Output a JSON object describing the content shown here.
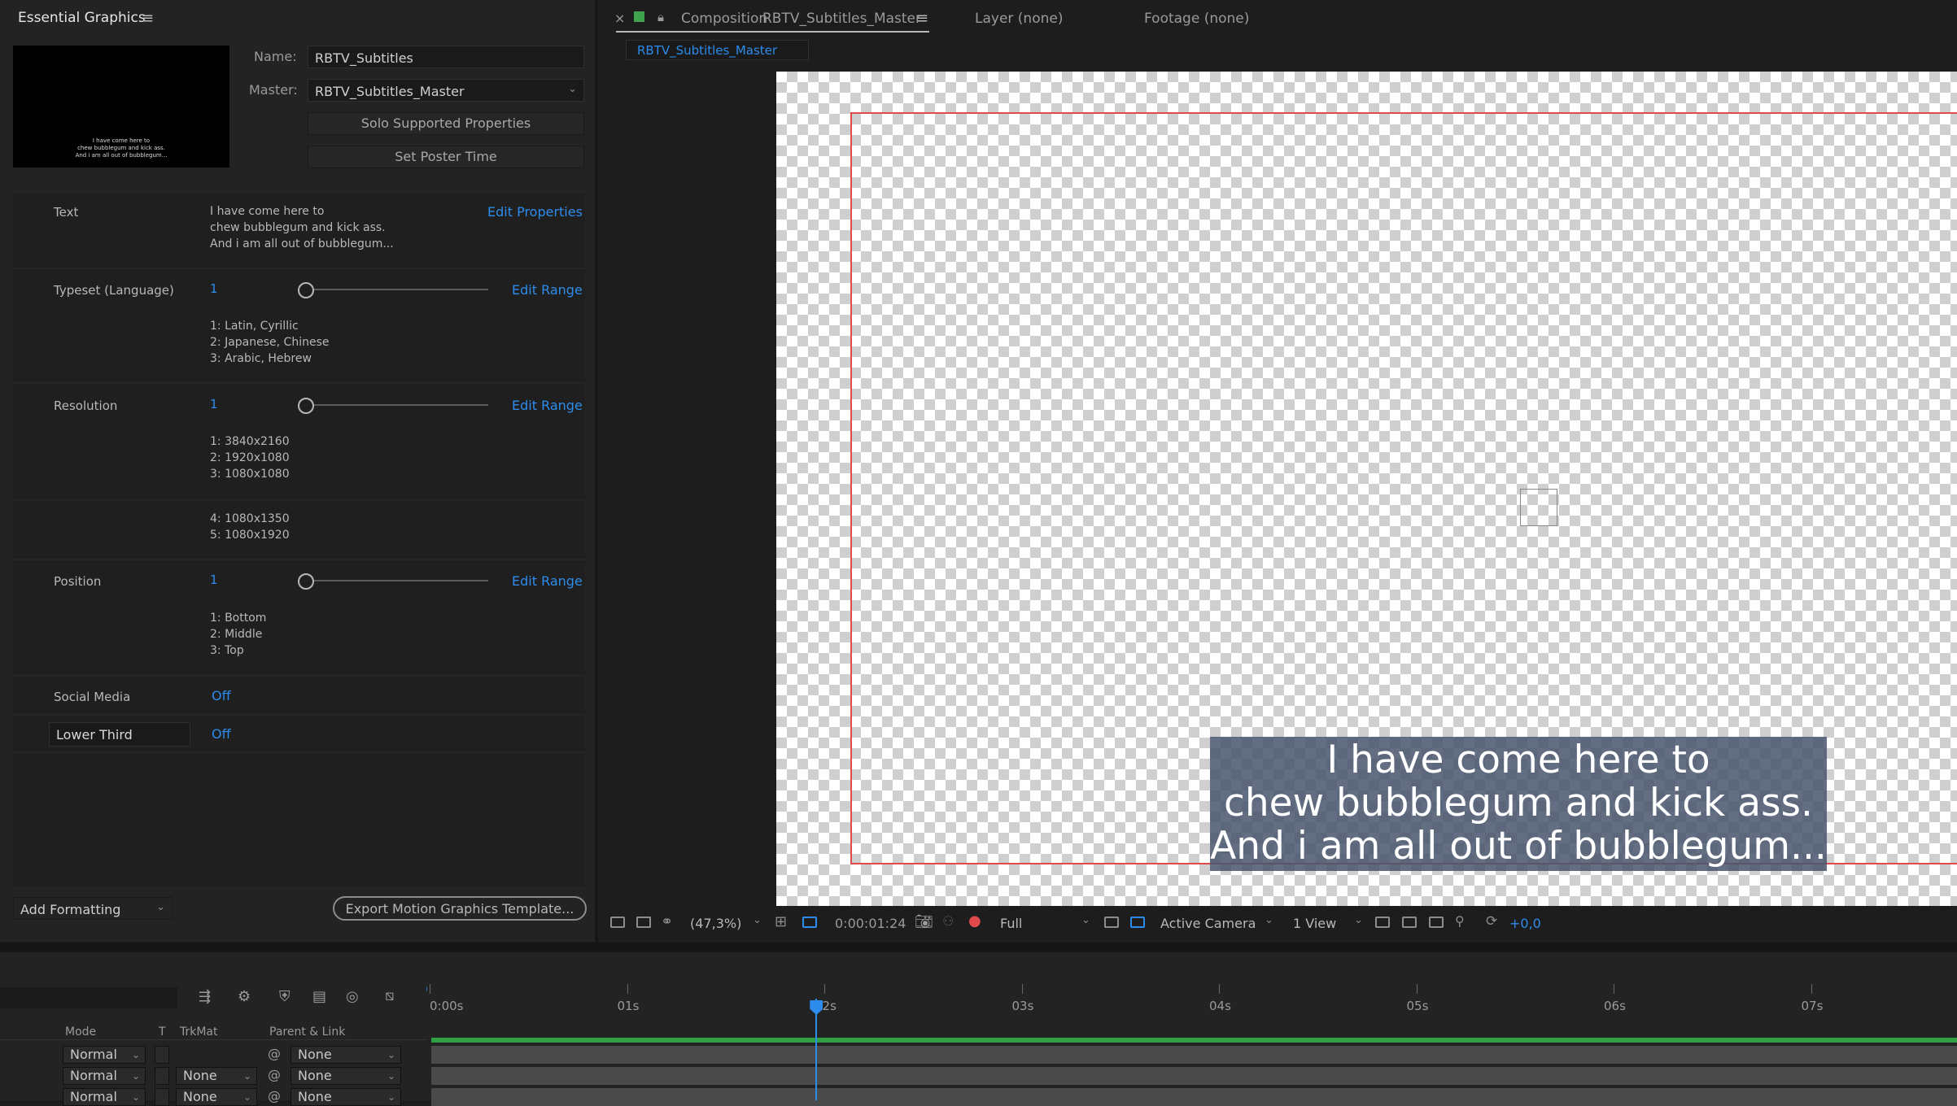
{
  "essential_graphics": {
    "title": "Essential Graphics",
    "menu_icon": "hamburger-icon",
    "thumbnail_text": "I have come here to\nchew bubblegum and kick ass.\nAnd i am all out of bubblegum...",
    "name_label": "Name:",
    "name_value": "RBTV_Subtitles",
    "master_label": "Master:",
    "master_value": "RBTV_Subtitles_Master",
    "solo_button": "Solo Supported Properties",
    "poster_button": "Set Poster Time",
    "properties": {
      "text": {
        "label": "Text",
        "value": "I have come here to\nchew bubblegum and kick ass.\nAnd i am all out of bubblegum...",
        "action": "Edit Properties"
      },
      "typeset": {
        "label": "Typeset (Language)",
        "value": "1",
        "slider_fraction": 0,
        "action": "Edit Range",
        "options": "1: Latin, Cyrillic\n2: Japanese, Chinese\n3: Arabic, Hebrew"
      },
      "resolution": {
        "label": "Resolution",
        "value": "1",
        "slider_fraction": 0,
        "action": "Edit Range",
        "options_a": "1: 3840x2160\n2: 1920x1080\n3: 1080x1080",
        "options_b": "4: 1080x1350\n5: 1080x1920"
      },
      "position": {
        "label": "Position",
        "value": "1",
        "slider_fraction": 0,
        "action": "Edit Range",
        "options": "1: Bottom\n2: Middle\n3: Top"
      },
      "social_media": {
        "label": "Social Media",
        "value": "Off"
      },
      "lower_third": {
        "label": "Lower Third",
        "value": "Off"
      }
    },
    "add_formatting": "Add Formatting",
    "export_button": "Export Motion Graphics Template..."
  },
  "composition": {
    "close": "×",
    "tab_prefix": "Composition",
    "tab_name": "RBTV_Subtitles_Master",
    "layer_tab": "Layer (none)",
    "footage_tab": "Footage (none)",
    "breadcrumb": "RBTV_Subtitles_Master",
    "subtitle": "I have come here to\nchew bubblegum and kick ass.\nAnd i am all out of bubblegum...",
    "toolbar": {
      "zoom": "(47,3%)",
      "timecode": "0:00:01:24",
      "resolution": "Full",
      "camera": "Active Camera",
      "views": "1 View",
      "exposure": "+0,0"
    },
    "accent_color": "#2d8ceb",
    "label_color": "#3fa34d"
  },
  "timeline": {
    "ruler_labels": [
      "0:00s",
      "01s",
      "02s",
      "03s",
      "04s",
      "05s",
      "06s",
      "07s"
    ],
    "current_time_seconds": 1.96,
    "columns": {
      "mode": "Mode",
      "t": "T",
      "trkmat": "TrkMat",
      "parent": "Parent & Link"
    },
    "rows": [
      {
        "mode": "Normal",
        "trkmat": "",
        "parent": "None"
      },
      {
        "mode": "Normal",
        "trkmat": "None",
        "parent": "None"
      },
      {
        "mode": "Normal",
        "trkmat": "None",
        "parent": "None"
      }
    ]
  }
}
